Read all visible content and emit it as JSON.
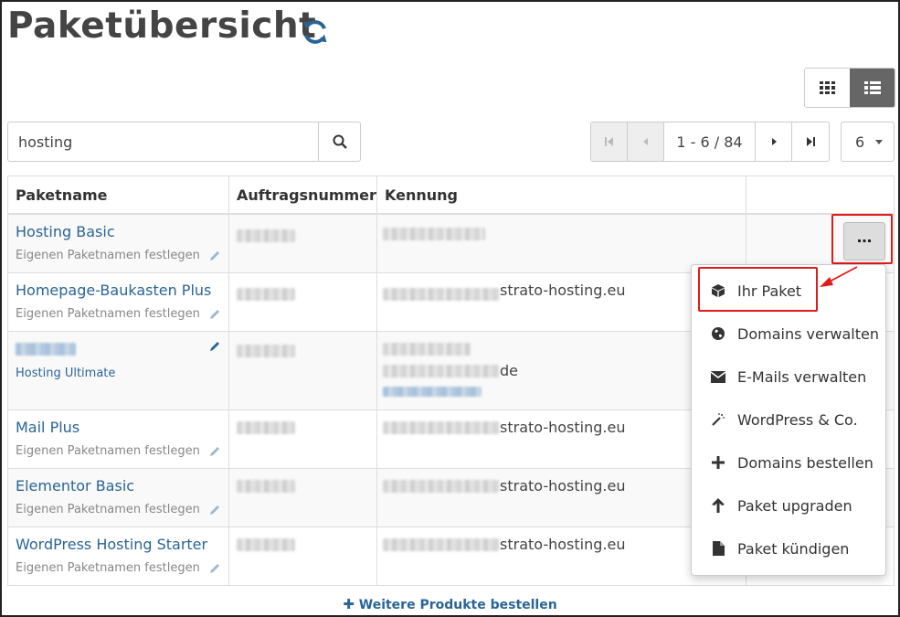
{
  "page": {
    "title": "Paketübersicht"
  },
  "search": {
    "value": "hosting"
  },
  "pagination": {
    "range": "1 - 6 / 84",
    "per_page": "6"
  },
  "table": {
    "headers": [
      "Paketname",
      "Auftragsnummer",
      "Kennung",
      ""
    ],
    "rows": [
      {
        "name": "Hosting Basic",
        "subtitle": "Eigenen Paketnamen festlegen",
        "kennung_suffix": ""
      },
      {
        "name": "Homepage-Baukasten Plus",
        "subtitle": "Eigenen Paketnamen festlegen",
        "kennung_suffix": "strato-hosting.eu"
      },
      {
        "name": "",
        "subtitle": "Hosting Ultimate",
        "kennung_suffix": "de"
      },
      {
        "name": "Mail Plus",
        "subtitle": "Eigenen Paketnamen festlegen",
        "kennung_suffix": "strato-hosting.eu"
      },
      {
        "name": "Elementor Basic",
        "subtitle": "Eigenen Paketnamen festlegen",
        "kennung_suffix": "strato-hosting.eu"
      },
      {
        "name": "WordPress Hosting Starter",
        "subtitle": "Eigenen Paketnamen festlegen",
        "kennung_suffix": "strato-hosting.eu"
      }
    ]
  },
  "footer": {
    "order_more": "Weitere Produkte bestellen"
  },
  "menu": {
    "items": [
      {
        "label": "Ihr Paket",
        "icon": "cube-icon"
      },
      {
        "label": "Domains verwalten",
        "icon": "globe-icon"
      },
      {
        "label": "E-Mails verwalten",
        "icon": "envelope-icon"
      },
      {
        "label": "WordPress & Co.",
        "icon": "magic-wand-icon"
      },
      {
        "label": "Domains bestellen",
        "icon": "plus-icon"
      },
      {
        "label": "Paket upgraden",
        "icon": "arrow-up-icon"
      },
      {
        "label": "Paket kündigen",
        "icon": "file-icon"
      }
    ]
  },
  "colors": {
    "link": "#2a6496",
    "highlight": "#e01b1b",
    "active_toggle": "#666666"
  }
}
